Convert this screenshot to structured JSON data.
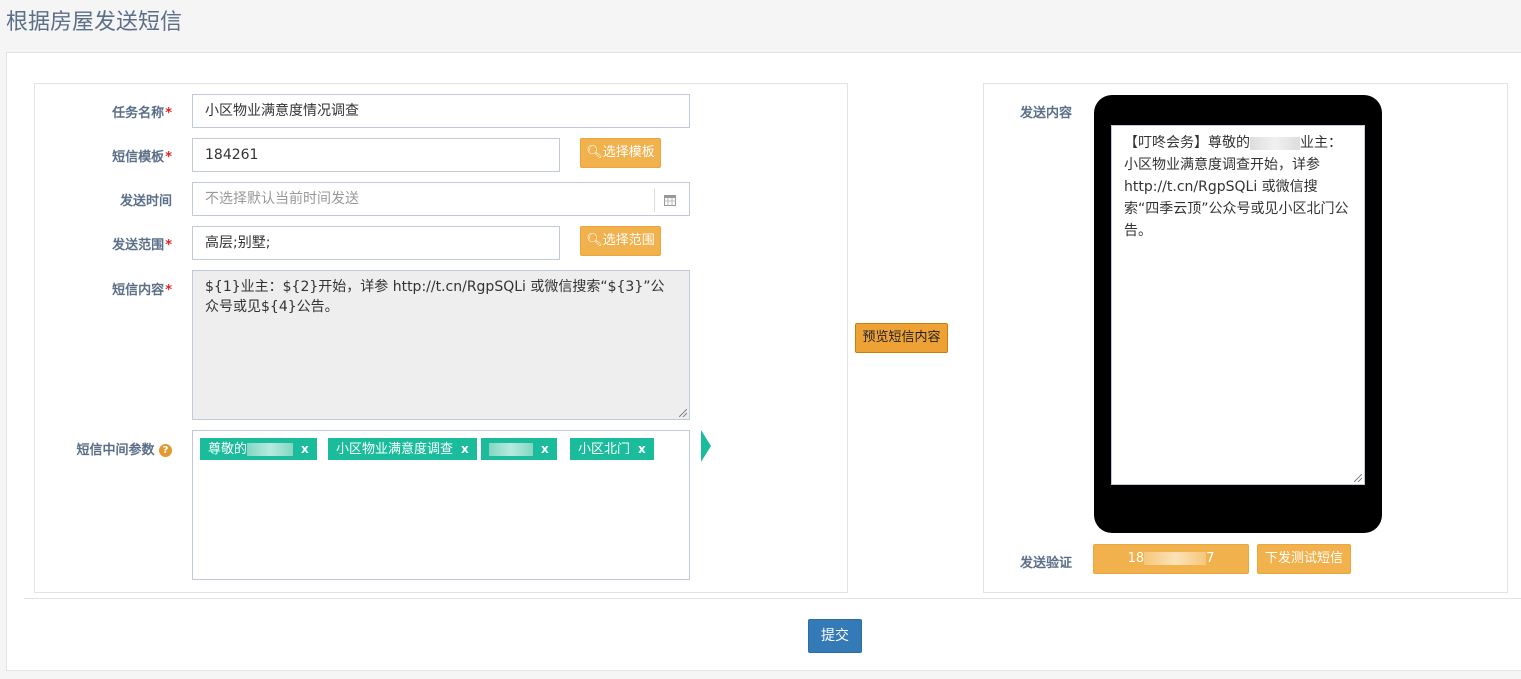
{
  "page": {
    "title": "根据房屋发送短信"
  },
  "form": {
    "task_name_label": "任务名称",
    "task_name_value": "小区物业满意度情况调查",
    "template_label": "短信模板",
    "template_value": "184261",
    "select_template_btn": "选择模板",
    "send_time_label": "发送时间",
    "send_time_placeholder": "不选择默认当前时间发送",
    "range_label": "发送范围",
    "range_value": "高层;别墅;",
    "select_range_btn": "选择范围",
    "content_label": "短信内容",
    "content_value": "${1}业主：${2}开始，详参 http://t.cn/RgpSQLi 或微信搜索“${3}”公众号或见${4}公告。",
    "params_label": "短信中间参数",
    "required_mark": "*"
  },
  "params": [
    {
      "label": "尊敬的",
      "remove": "x"
    },
    {
      "label": "小区物业满意度调查",
      "remove": "x"
    },
    {
      "label": "",
      "remove": "x"
    },
    {
      "label": "小区北门",
      "remove": "x"
    }
  ],
  "preview": {
    "button": "预览短信内容",
    "send_content_label": "发送内容",
    "sms_part1": "【叮咚会务】尊敬的",
    "sms_part2": "业主：小区物业满意度调查开始，详参 http://t.cn/RgpSQLi 或微信搜索“四季云顶”公众号或见小区北门公告。",
    "verify_label": "发送验证",
    "phone_prefix": "18",
    "phone_suffix": "7",
    "send_test_btn": "下发测试短信"
  },
  "submit": {
    "label": "提交"
  },
  "colors": {
    "accent": "#f1b14c",
    "tag": "#1abc9c",
    "primary": "#337ab7",
    "label": "#5b6f89"
  }
}
